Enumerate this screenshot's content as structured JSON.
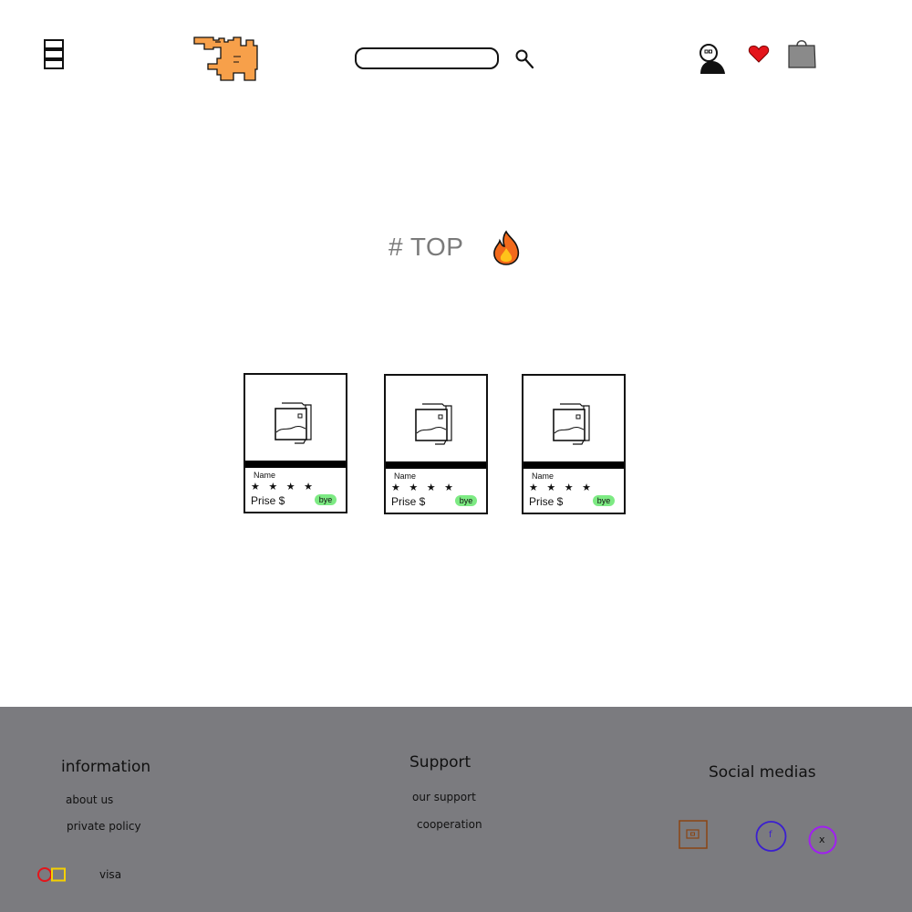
{
  "header": {
    "menu_icon": "hamburger-menu-icon",
    "logo_icon": "orange-pixel-logo",
    "search": {
      "placeholder": "",
      "value": ""
    },
    "search_icon": "magnifier-icon",
    "user_icon": "user-icon",
    "favorites_icon": "heart-icon",
    "cart_icon": "shopping-bag-icon"
  },
  "top_section": {
    "title": "# TOP",
    "icon": "fire-icon"
  },
  "products": [
    {
      "name": "Name",
      "stars": "★ ★ ★ ★",
      "rating": 4,
      "price_label": "Prise $",
      "buy_label": "bye"
    },
    {
      "name": "Name",
      "stars": "★ ★ ★ ★",
      "rating": 4,
      "price_label": "Prise $",
      "buy_label": "bye"
    },
    {
      "name": "Name",
      "stars": "★ ★ ★ ★",
      "rating": 4,
      "price_label": "Prise $",
      "buy_label": "bye"
    }
  ],
  "footer": {
    "information": {
      "heading": "information",
      "links": [
        "about us",
        "private policy"
      ]
    },
    "support": {
      "heading": "Support",
      "links": [
        "our support",
        "cooperation"
      ]
    },
    "social": {
      "heading": "Social medias",
      "items": [
        {
          "icon": "instagram-icon",
          "label": ""
        },
        {
          "icon": "facebook-icon",
          "label": "f"
        },
        {
          "icon": "x-icon",
          "label": "x"
        }
      ]
    },
    "payment": {
      "icon": "mastercard-icon",
      "label": "visa"
    }
  },
  "colors": {
    "logo": "#f7a04a",
    "heart": "#e4151b",
    "bag": "#8a8a8a",
    "buy_button": "#7dea83",
    "footer_bg": "#7b7b7f",
    "instagram": "#8b4513",
    "facebook": "#3b1fd0",
    "x": "#a020f0"
  }
}
